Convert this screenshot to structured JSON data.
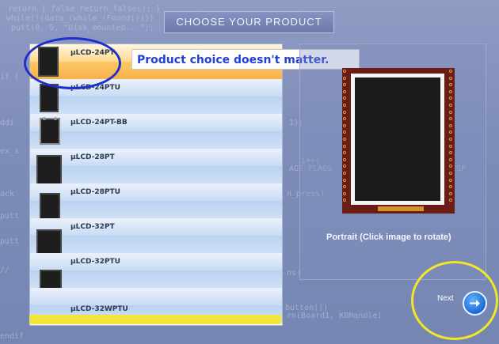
{
  "header": {
    "title": "CHOOSE YOUR PRODUCT"
  },
  "products": [
    {
      "name": "μLCD-24PT",
      "selected": true
    },
    {
      "name": "μLCD-24PTU",
      "selected": false
    },
    {
      "name": "μLCD-24PT-BB",
      "selected": false
    },
    {
      "name": "μLCD-28PT",
      "selected": false
    },
    {
      "name": "μLCD-28PTU",
      "selected": false
    },
    {
      "name": "μLCD-32PT",
      "selected": false
    },
    {
      "name": "μLCD-32PTU",
      "selected": false
    },
    {
      "name": "μLCD-32WPTU",
      "selected": false
    }
  ],
  "annotation": {
    "text": "Product choice doesn't matter."
  },
  "preview": {
    "caption": "Portrait (Click image to rotate)"
  },
  "navigation": {
    "next_label": "Next"
  },
  "colors": {
    "background": "#7e8db8",
    "selected_row": "#f7b24a",
    "annotation_text": "#2040d8",
    "highlight_ellipse_blue": "#1f2fcf",
    "highlight_ellipse_yellow": "#f1e628",
    "bottom_bar": "#f2e63d"
  },
  "icons": {
    "next": "arrow-right-circle-icon"
  }
}
